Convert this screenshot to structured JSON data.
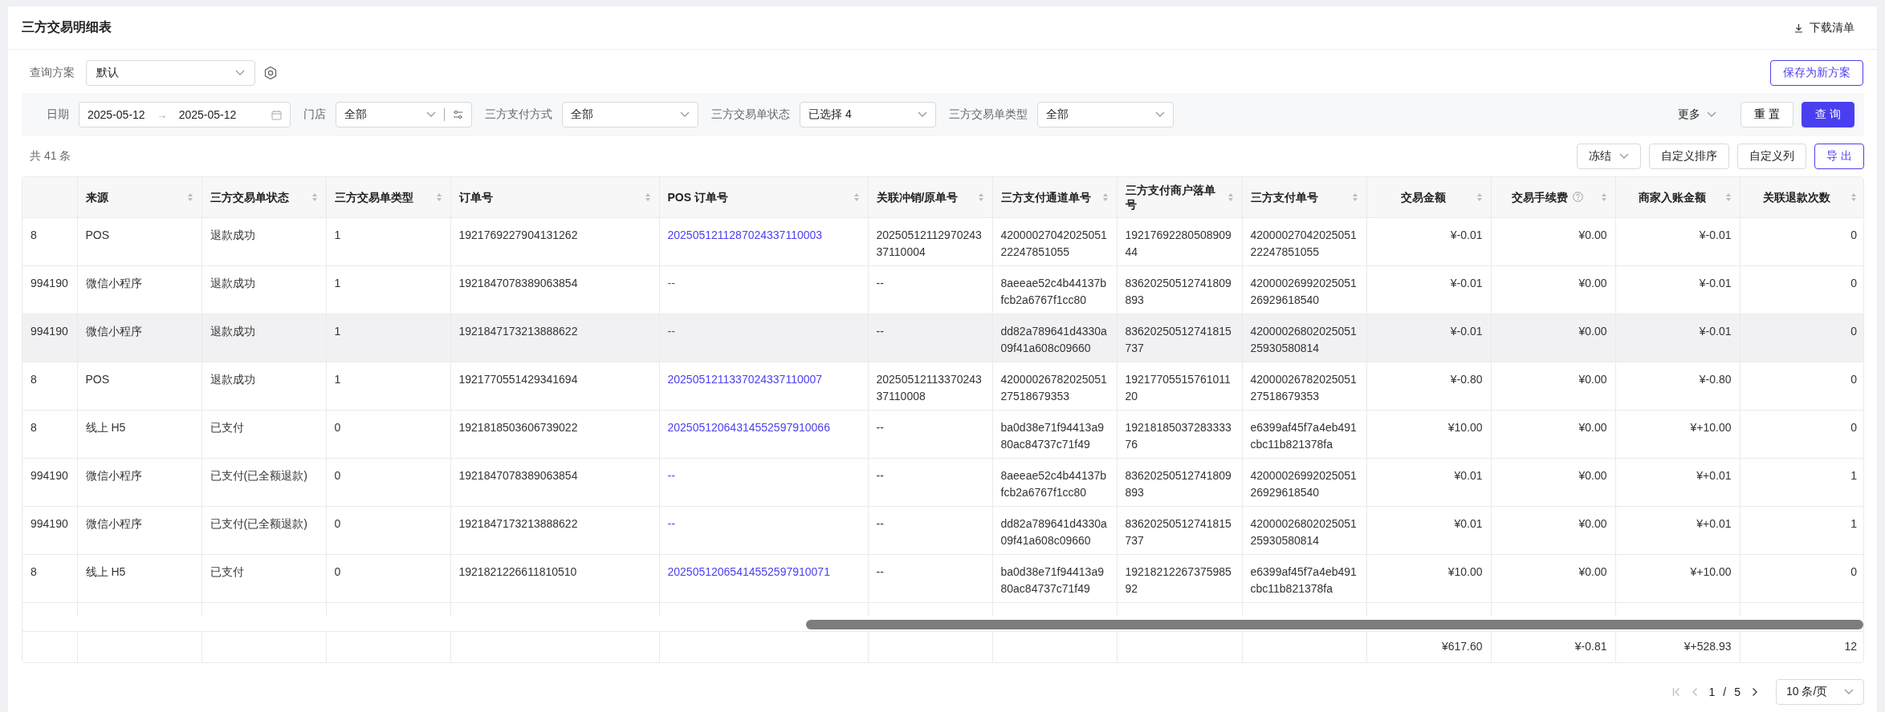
{
  "page": {
    "title": "三方交易明细表",
    "download_button": "下载清单"
  },
  "scheme": {
    "label": "查询方案",
    "value": "默认",
    "save_button": "保存为新方案"
  },
  "filters": [
    {
      "kind": "daterange",
      "label": "日期",
      "start": "2025-05-12",
      "separator": "→",
      "end": "2025-05-12"
    },
    {
      "kind": "select-config",
      "label": "门店",
      "value": "全部"
    },
    {
      "kind": "select",
      "label": "三方支付方式",
      "value": "全部"
    },
    {
      "kind": "select",
      "label": "三方交易单状态",
      "value": "已选择 4"
    },
    {
      "kind": "select",
      "label": "三方交易单类型",
      "value": "全部"
    }
  ],
  "filter_actions": {
    "more": "更多",
    "reset": "重 置",
    "search": "查 询"
  },
  "total": "共 41 条",
  "toolbar": [
    {
      "kind": "dropdown",
      "label": "冻结"
    },
    {
      "kind": "plain",
      "label": "自定义排序"
    },
    {
      "kind": "plain",
      "label": "自定义列"
    },
    {
      "kind": "accent",
      "label": "导 出"
    }
  ],
  "table": {
    "columns": [
      {
        "kind": "clipped"
      },
      {
        "label": "来源",
        "kind": "text"
      },
      {
        "label": "三方交易单状态",
        "kind": "text"
      },
      {
        "label": "三方交易单类型",
        "kind": "text"
      },
      {
        "label": "订单号",
        "kind": "text"
      },
      {
        "label": "POS 订单号",
        "kind": "link"
      },
      {
        "label": "关联冲销/原单号",
        "kind": "text"
      },
      {
        "label": "三方支付通道单号",
        "kind": "text"
      },
      {
        "label": "三方支付商户落单号",
        "kind": "text"
      },
      {
        "label": "三方支付单号",
        "kind": "text"
      },
      {
        "label": "交易金额",
        "kind": "amount"
      },
      {
        "label": "交易手续费",
        "kind": "hinted"
      },
      {
        "label": "商家入账金额",
        "kind": "amount"
      },
      {
        "label": "关联退款次数",
        "kind": "amount"
      }
    ],
    "rows": [
      {
        "highlighted": false,
        "cells": [
          "8",
          "POS",
          "退款成功",
          "1",
          "1921769227904131262",
          "2025051211287024337110003",
          "2025051211297024337110004",
          "4200002704202505122247851055",
          "1921769228050890944",
          "4200002704202505122247851055",
          "¥-0.01",
          "¥0.00",
          "¥-0.01",
          "0"
        ]
      },
      {
        "highlighted": false,
        "cells": [
          "994190",
          "微信小程序",
          "退款成功",
          "1",
          "1921847078389063854",
          "--",
          "--",
          "8aeeae52c4b44137bfcb2a6767f1cc80",
          "83620250512741809893",
          "4200002699202505126929618540",
          "¥-0.01",
          "¥0.00",
          "¥-0.01",
          "0"
        ]
      },
      {
        "highlighted": true,
        "cells": [
          "994190",
          "微信小程序",
          "退款成功",
          "1",
          "1921847173213888622",
          "--",
          "--",
          "dd82a789641d4330a09f41a608c09660",
          "83620250512741815737",
          "4200002680202505125930580814",
          "¥-0.01",
          "¥0.00",
          "¥-0.01",
          "0"
        ]
      },
      {
        "highlighted": false,
        "cells": [
          "8",
          "POS",
          "退款成功",
          "1",
          "1921770551429341694",
          "2025051211337024337110007",
          "2025051211337024337110008",
          "4200002678202505127518679353",
          "1921770551576101120",
          "4200002678202505127518679353",
          "¥-0.80",
          "¥0.00",
          "¥-0.80",
          "0"
        ]
      },
      {
        "highlighted": false,
        "cells": [
          "8",
          "线上 H5",
          "已支付",
          "0",
          "1921818503606739022",
          "20250512064314552597910066",
          "--",
          "ba0d38e71f94413a980ac84737c71f49",
          "1921818503728333376",
          "e6399af45f7a4eb491cbc11b821378fa",
          "¥10.00",
          "¥0.00",
          "¥+10.00",
          "0"
        ]
      },
      {
        "highlighted": false,
        "cells": [
          "994190",
          "微信小程序",
          "已支付(已全额退款)",
          "0",
          "1921847078389063854",
          "--",
          "--",
          "8aeeae52c4b44137bfcb2a6767f1cc80",
          "83620250512741809893",
          "4200002699202505126929618540",
          "¥0.01",
          "¥0.00",
          "¥+0.01",
          "1"
        ]
      },
      {
        "highlighted": false,
        "cells": [
          "994190",
          "微信小程序",
          "已支付(已全额退款)",
          "0",
          "1921847173213888622",
          "--",
          "--",
          "dd82a789641d4330a09f41a608c09660",
          "83620250512741815737",
          "4200002680202505125930580814",
          "¥0.01",
          "¥0.00",
          "¥+0.01",
          "1"
        ]
      },
      {
        "highlighted": false,
        "cells": [
          "8",
          "线上 H5",
          "已支付",
          "0",
          "1921821226611810510",
          "20250512065414552597910071",
          "--",
          "ba0d38e71f94413a980ac84737c71f49",
          "1921821226737598592",
          "e6399af45f7a4eb491cbc11b821378fa",
          "¥10.00",
          "¥0.00",
          "¥+10.00",
          "0"
        ]
      }
    ],
    "summary": [
      "¥617.60",
      "¥-0.81",
      "¥+528.93",
      "12"
    ]
  },
  "pagination": {
    "current": "1",
    "separator": "/",
    "total": "5",
    "page_size": "10 条/页"
  }
}
